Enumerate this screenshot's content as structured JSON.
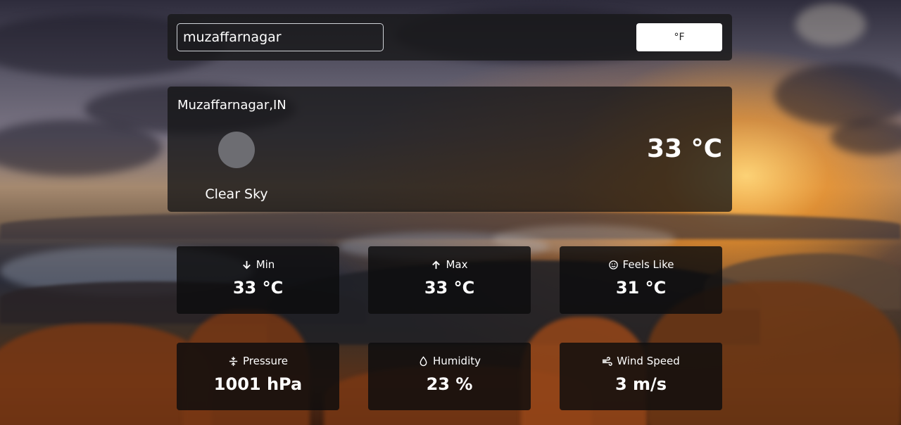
{
  "search": {
    "value": "muzaffarnagar"
  },
  "unit_toggle": {
    "label": "°F"
  },
  "current": {
    "location": "Muzaffarnagar,IN",
    "description": "Clear Sky",
    "temperature": "33 °C",
    "icon": "weather-icon"
  },
  "stats": [
    {
      "icon": "arrow-down-icon",
      "label": "Min",
      "value": "33 °C"
    },
    {
      "icon": "arrow-up-icon",
      "label": "Max",
      "value": "33 °C"
    },
    {
      "icon": "smile-icon",
      "label": "Feels Like",
      "value": "31 °C"
    },
    {
      "icon": "pressure-icon",
      "label": "Pressure",
      "value": "1001 hPa"
    },
    {
      "icon": "droplet-icon",
      "label": "Humidity",
      "value": "23 %"
    },
    {
      "icon": "wind-icon",
      "label": "Wind Speed",
      "value": "3 m/s"
    }
  ]
}
